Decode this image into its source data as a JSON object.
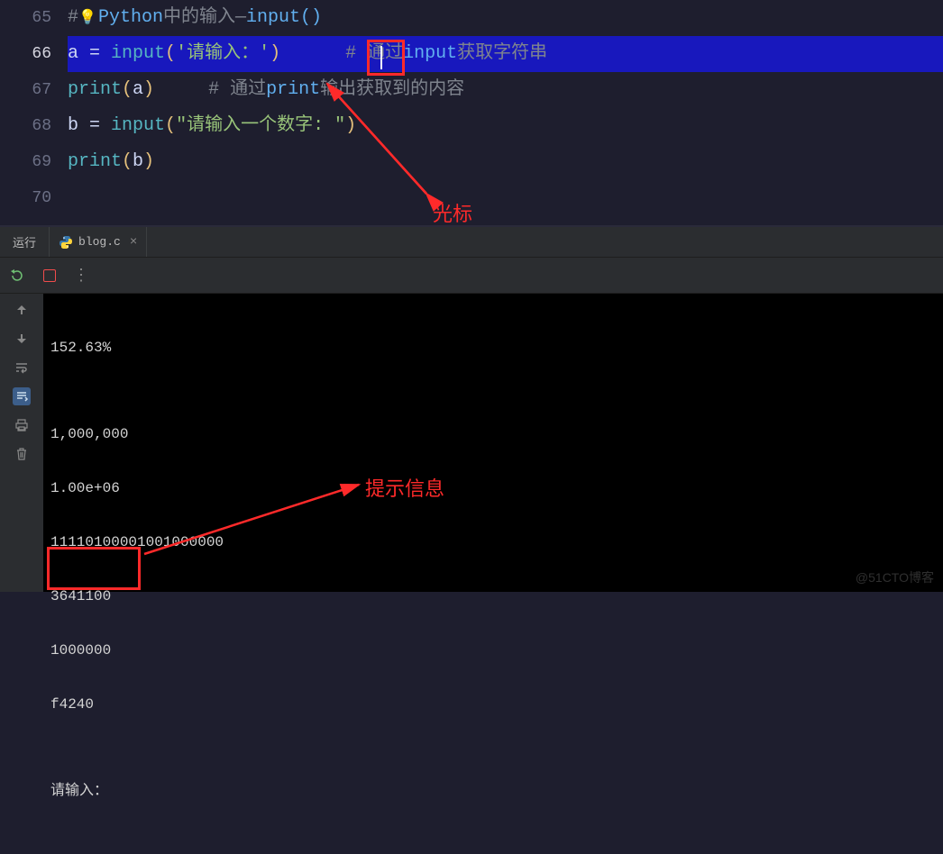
{
  "editor": {
    "lines": [
      {
        "num": "65",
        "active": false
      },
      {
        "num": "66",
        "active": true
      },
      {
        "num": "67",
        "active": false
      },
      {
        "num": "68",
        "active": false
      },
      {
        "num": "69",
        "active": false
      },
      {
        "num": "70",
        "active": false
      }
    ],
    "code": {
      "l65_comment_prefix": "#",
      "l65_comment_text_a": "Python",
      "l65_comment_text_b": "中的输入—",
      "l65_comment_text_c": "input()",
      "l66_var": "a",
      "l66_eq": " = ",
      "l66_fn": "input",
      "l66_par_o": "(",
      "l66_str": "'请输入：'",
      "l66_par_c": ")",
      "l66_cm_h": "      # 通过",
      "l66_cm_en": "input",
      "l66_cm_t": "获取字符串",
      "l67_fn": "print",
      "l67_par_o": "(",
      "l67_arg": "a",
      "l67_par_c": ")",
      "l67_cm_h": "     # 通过",
      "l67_cm_en": "print",
      "l67_cm_t": "输出获取到的内容",
      "l68_var": "b",
      "l68_eq": " = ",
      "l68_fn": "input",
      "l68_par_o": "(",
      "l68_str": "\"请输入一个数字: \"",
      "l68_par_c": ")",
      "l69_fn": "print",
      "l69_par_o": "(",
      "l69_arg": "b",
      "l69_par_c": ")"
    }
  },
  "run_panel": {
    "label": "运行",
    "tab_name": "blog.c",
    "close": "×"
  },
  "console": {
    "lines": [
      "152.63%",
      "",
      "1,000,000",
      "1.00e+06",
      "11110100001001000000",
      "3641100",
      "1000000",
      "f4240",
      "",
      "请输入："
    ]
  },
  "annotations": {
    "cursor": "光标",
    "prompt": "提示信息"
  },
  "watermark": "@51CTO博客",
  "icons": {
    "rerun": "rerun-icon",
    "stop": "stop-icon",
    "more": "more-icon",
    "up": "arrow-up-icon",
    "down": "arrow-down-icon",
    "wrap": "soft-wrap-icon",
    "scroll": "scroll-to-end-icon",
    "print": "print-icon",
    "trash": "trash-icon"
  }
}
